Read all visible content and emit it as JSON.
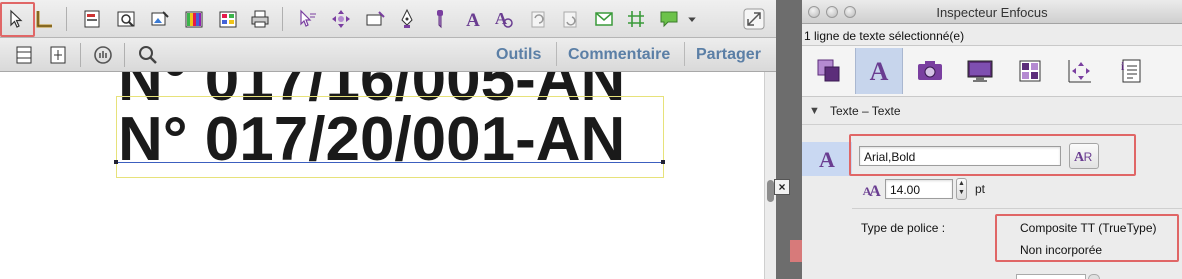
{
  "acrobat": {
    "nav": {
      "tools": "Outils",
      "comment": "Commentaire",
      "share": "Partager"
    },
    "document": {
      "line_previous": "N° 017/16/005-AN",
      "line_current": "N° 017/20/001-AN"
    },
    "toolbar_icons": [
      "select-object-icon",
      "measure-icon",
      "form-icon",
      "preview-icon",
      "image-edit-icon",
      "color-bars-icon",
      "palette-icon",
      "printer-icon",
      "pointer-tool-icon",
      "move-tool-icon",
      "box-tool-icon",
      "pen-tool-icon",
      "eyedropper-icon",
      "text-tool-icon",
      "text-path-icon",
      "rotate-icon",
      "scale-icon",
      "email-icon",
      "grid-icon",
      "comment-icon",
      "dropdown-icon",
      "expand-icon"
    ],
    "accent_colors": {
      "highlight": "#e06666",
      "link": "#5b7fa6",
      "selection_baseline": "#3c5fbf",
      "selection_box": "#e7e27a"
    }
  },
  "inspector": {
    "title": "Inspecteur Enfocus",
    "status": "1 ligne de texte sélectionné(e)",
    "tabs": [
      "object-icon",
      "text-icon",
      "image-icon",
      "monitor-icon",
      "color-grid-icon",
      "position-icon",
      "document-info-icon"
    ],
    "active_tab": "text-icon",
    "section": {
      "label": "Texte – Texte"
    },
    "font": {
      "value": "Arial,Bold",
      "size": "14.00",
      "unit": "pt"
    },
    "font_type": {
      "label": "Type de police :",
      "value_1": "Composite TT (TrueType)",
      "value_2": "Non incorporée"
    },
    "accent_colors": {
      "active_tab_bg": "#c7d5ec",
      "highlight": "#e06666"
    }
  }
}
